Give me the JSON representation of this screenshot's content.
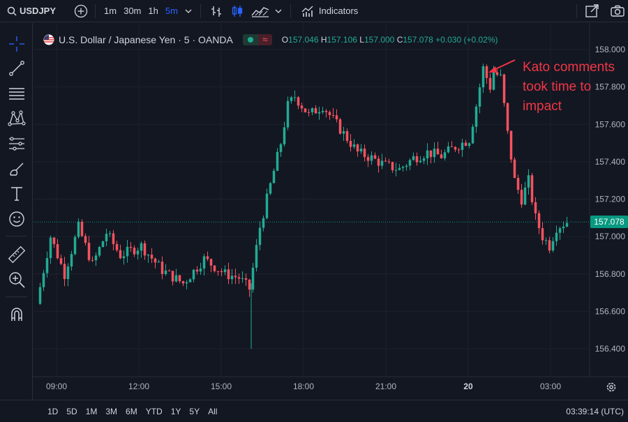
{
  "toolbar": {
    "symbol": "USDJPY",
    "intervals": [
      "1m",
      "30m",
      "1h",
      "5m"
    ],
    "active_interval": "5m",
    "indicators_label": "Indicators"
  },
  "legend": {
    "title": "U.S. Dollar / Japanese Yen · 5 · OANDA",
    "o_label": "O",
    "o": "157.046",
    "h_label": "H",
    "h": "157.106",
    "l_label": "L",
    "l": "157.000",
    "c_label": "C",
    "c": "157.078",
    "change": "+0.030 (+0.02%)"
  },
  "annotation": "Kato comments took time to impact",
  "current_price_label": "157.078",
  "price_axis": [
    "158.000",
    "157.800",
    "157.600",
    "157.400",
    "157.200",
    "157.000",
    "156.800",
    "156.600",
    "156.400"
  ],
  "time_axis": [
    "09:00",
    "12:00",
    "15:00",
    "18:00",
    "21:00",
    "20",
    "03:00"
  ],
  "bottom": {
    "ranges": [
      "1D",
      "5D",
      "1M",
      "3M",
      "6M",
      "YTD",
      "1Y",
      "5Y",
      "All"
    ],
    "clock": "03:39:14 (UTC)"
  },
  "colors": {
    "up": "#22ab94",
    "down": "#f7525f",
    "accent": "#2962ff",
    "annotation": "#f23645"
  },
  "chart_data": {
    "type": "candlestick",
    "title": "U.S. Dollar / Japanese Yen · 5 · OANDA",
    "ylim": [
      156.31,
      158.06
    ],
    "current_price": 157.078,
    "x_ticks": [
      "09:00",
      "12:00",
      "15:00",
      "18:00",
      "21:00",
      "20",
      "03:00"
    ],
    "y_ticks": [
      158.0,
      157.8,
      157.6,
      157.4,
      157.2,
      157.0,
      156.8,
      156.6,
      156.4
    ],
    "path": [
      [
        0,
        156.64
      ],
      [
        4,
        157.0
      ],
      [
        8,
        156.8
      ],
      [
        12,
        157.05
      ],
      [
        16,
        156.85
      ],
      [
        20,
        157.02
      ],
      [
        24,
        156.9
      ],
      [
        30,
        156.95
      ],
      [
        36,
        156.82
      ],
      [
        42,
        156.75
      ],
      [
        48,
        156.88
      ],
      [
        54,
        156.8
      ],
      [
        58,
        156.78
      ],
      [
        61,
        156.72
      ],
      [
        64,
        157.05
      ],
      [
        66,
        157.2
      ],
      [
        68,
        157.35
      ],
      [
        70,
        157.5
      ],
      [
        72,
        157.7
      ],
      [
        74,
        157.75
      ],
      [
        78,
        157.65
      ],
      [
        82,
        157.7
      ],
      [
        86,
        157.6
      ],
      [
        88,
        157.55
      ],
      [
        92,
        157.45
      ],
      [
        96,
        157.42
      ],
      [
        100,
        157.38
      ],
      [
        104,
        157.36
      ],
      [
        108,
        157.42
      ],
      [
        112,
        157.45
      ],
      [
        116,
        157.43
      ],
      [
        120,
        157.48
      ],
      [
        124,
        157.52
      ],
      [
        126,
        157.7
      ],
      [
        128,
        157.9
      ],
      [
        130,
        157.8
      ],
      [
        131,
        157.88
      ],
      [
        133,
        157.85
      ],
      [
        135,
        157.55
      ],
      [
        137,
        157.3
      ],
      [
        139,
        157.2
      ],
      [
        141,
        157.3
      ],
      [
        143,
        157.1
      ],
      [
        145,
        157.0
      ],
      [
        147,
        156.95
      ],
      [
        149,
        157.05
      ],
      [
        152,
        157.078
      ]
    ]
  }
}
